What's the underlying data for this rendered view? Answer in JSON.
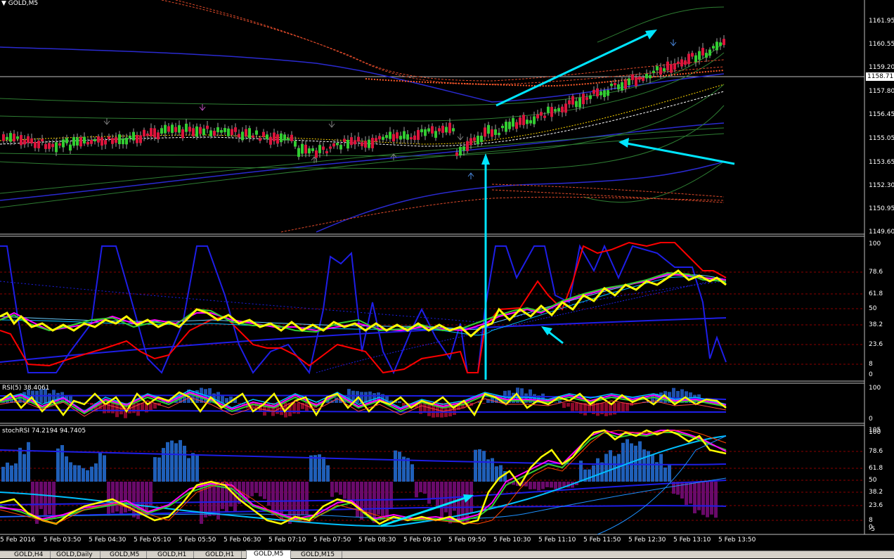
{
  "symbol_title": "GOLD,M5",
  "current_price": "1158.71",
  "main_price_labels": [
    "1161.95",
    "1160.55",
    "1159.20",
    "1157.80",
    "1156.45",
    "1155.05",
    "1153.65",
    "1152.30",
    "1150.95",
    "1149.60"
  ],
  "rsi_multi_labels": [
    "100",
    "78.6",
    "61.8",
    "50",
    "38.2",
    "23.6",
    "8",
    "0"
  ],
  "rsi_title": "RSI(5) 38.4061",
  "rsi_labels": [
    "100",
    "0"
  ],
  "stoch_title": "stochRSI 74.2194 94.7405",
  "stoch_labels": [
    "105",
    "100",
    "78.6",
    "61.8",
    "50",
    "38.2",
    "23.6",
    "8",
    "0",
    "-5"
  ],
  "time_labels": [
    "5 Feb 2016",
    "5 Feb 03:50",
    "5 Feb 04:30",
    "5 Feb 05:10",
    "5 Feb 05:50",
    "5 Feb 06:30",
    "5 Feb 07:10",
    "5 Feb 07:50",
    "5 Feb 08:30",
    "5 Feb 09:10",
    "5 Feb 09:50",
    "5 Feb 10:30",
    "5 Feb 11:10",
    "5 Feb 11:50",
    "5 Feb 12:30",
    "5 Feb 13:10",
    "5 Feb 13:50"
  ],
  "tabs": [
    {
      "label": "GOLD,H4",
      "active": false
    },
    {
      "label": "GOLD,Daily",
      "active": false
    },
    {
      "label": "GOLD,M5",
      "active": false
    },
    {
      "label": "GOLD,H1",
      "active": false
    },
    {
      "label": "GOLD,H1",
      "active": false
    },
    {
      "label": "GOLD,M5",
      "active": true
    },
    {
      "label": "GOLD,M15",
      "active": false
    }
  ],
  "colors": {
    "bull": "#32cd32",
    "bear": "#dc143c",
    "arrow": "#00ffff",
    "yellow": "#ffff00",
    "blue": "#1e1ee6",
    "red": "#ff0000"
  }
}
